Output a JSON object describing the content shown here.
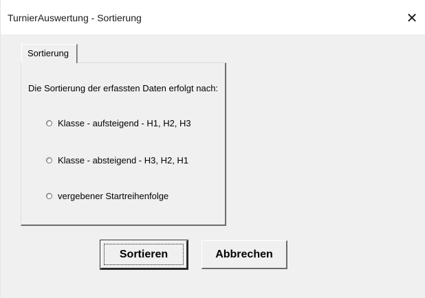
{
  "window": {
    "title": "TurnierAuswertung - Sortierung",
    "close_glyph": "✕"
  },
  "tab": {
    "label": "Sortierung"
  },
  "panel": {
    "description": "Die Sortierung der erfassten Daten erfolgt nach:",
    "options": [
      {
        "label": "Klasse - aufsteigend - H1, H2, H3",
        "selected": false
      },
      {
        "label": "Klasse - absteigend - H3, H2, H1",
        "selected": false
      },
      {
        "label": "vergebener Startreihenfolge",
        "selected": false
      }
    ]
  },
  "buttons": {
    "sort_label": "Sortieren",
    "cancel_label": "Abbrechen"
  }
}
